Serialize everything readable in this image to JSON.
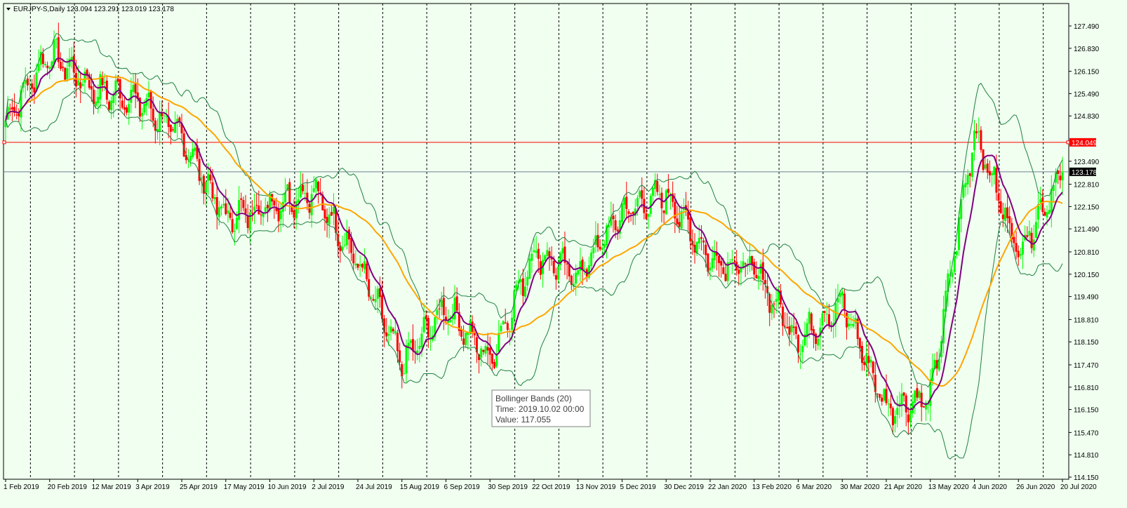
{
  "header": {
    "symbol_timeframe": "EURJPY-S,Daily",
    "ohlc": "123.094 123.291 123.019 123.178"
  },
  "tooltip": {
    "title": "Bollinger Bands (20)",
    "time": "Time: 2019.10.02 00:00",
    "value": "Value: 117.055"
  },
  "colors": {
    "background": "#f0fff0",
    "bull": "#00ff00",
    "bear": "#ff0000",
    "bands": "#208040",
    "ma_fast": "#800080",
    "ma_slow": "#ffa500",
    "hline_red": "#ff0000",
    "hline_price": "#708090",
    "grid": "#000000"
  },
  "chart_data": {
    "type": "candlestick",
    "symbol": "EURJPY-S",
    "timeframe": "Daily",
    "ylim": [
      114.15,
      127.85
    ],
    "y_ticks": [
      "127.490",
      "126.830",
      "126.150",
      "125.490",
      "124.830",
      "123.490",
      "122.810",
      "122.150",
      "121.490",
      "120.810",
      "120.150",
      "119.490",
      "118.810",
      "118.150",
      "117.470",
      "116.810",
      "116.150",
      "115.470",
      "114.810",
      "114.150"
    ],
    "x_ticks": [
      "1 Feb 2019",
      "20 Feb 2019",
      "12 Mar 2019",
      "3 Apr 2019",
      "25 Apr 2019",
      "17 May 2019",
      "10 Jun 2019",
      "2 Jul 2019",
      "24 Jul 2019",
      "15 Aug 2019",
      "6 Sep 2019",
      "30 Sep 2019",
      "22 Oct 2019",
      "13 Nov 2019",
      "5 Dec 2019",
      "30 Dec 2019",
      "22 Jan 2020",
      "13 Feb 2020",
      "6 Mar 2020",
      "30 Mar 2020",
      "21 Apr 2020",
      "13 May 2020",
      "4 Jun 2020",
      "26 Jun 2020",
      "20 Jul 2020"
    ],
    "period_separators": 24,
    "hlines": [
      {
        "value": 124.049,
        "label": "124.049",
        "style": "red"
      },
      {
        "value": 123.178,
        "label": "123.178",
        "style": "price"
      }
    ],
    "close_path": [
      [
        "1 Feb 2019",
        124.7
      ],
      [
        "20 Feb 2019",
        126.7
      ],
      [
        "12 Mar 2019",
        125.6
      ],
      [
        "3 Apr 2019",
        125.3
      ],
      [
        "25 Apr 2019",
        124.2
      ],
      [
        "17 May 2019",
        121.8
      ],
      [
        "10 Jun 2019",
        122.2
      ],
      [
        "2 Jul 2019",
        122.6
      ],
      [
        "24 Jul 2019",
        120.5
      ],
      [
        "15 Aug 2019",
        117.5
      ],
      [
        "6 Sep 2019",
        119.2
      ],
      [
        "30 Sep 2019",
        117.6
      ],
      [
        "22 Oct 2019",
        120.8
      ],
      [
        "13 Nov 2019",
        120.1
      ],
      [
        "5 Dec 2019",
        122.0
      ],
      [
        "30 Dec 2019",
        122.5
      ],
      [
        "22 Jan 2020",
        120.6
      ],
      [
        "13 Feb 2020",
        120.3
      ],
      [
        "6 Mar 2020",
        118.2
      ],
      [
        "30 Mar 2020",
        119.3
      ],
      [
        "21 Apr 2020",
        116.2
      ],
      [
        "13 May 2020",
        116.5
      ],
      [
        "4 Jun 2020",
        124.4
      ],
      [
        "26 Jun 2020",
        120.8
      ],
      [
        "20 Jul 2020",
        123.18
      ]
    ],
    "indicators": [
      "Bollinger Bands (20)",
      "MA fast",
      "MA slow"
    ]
  }
}
